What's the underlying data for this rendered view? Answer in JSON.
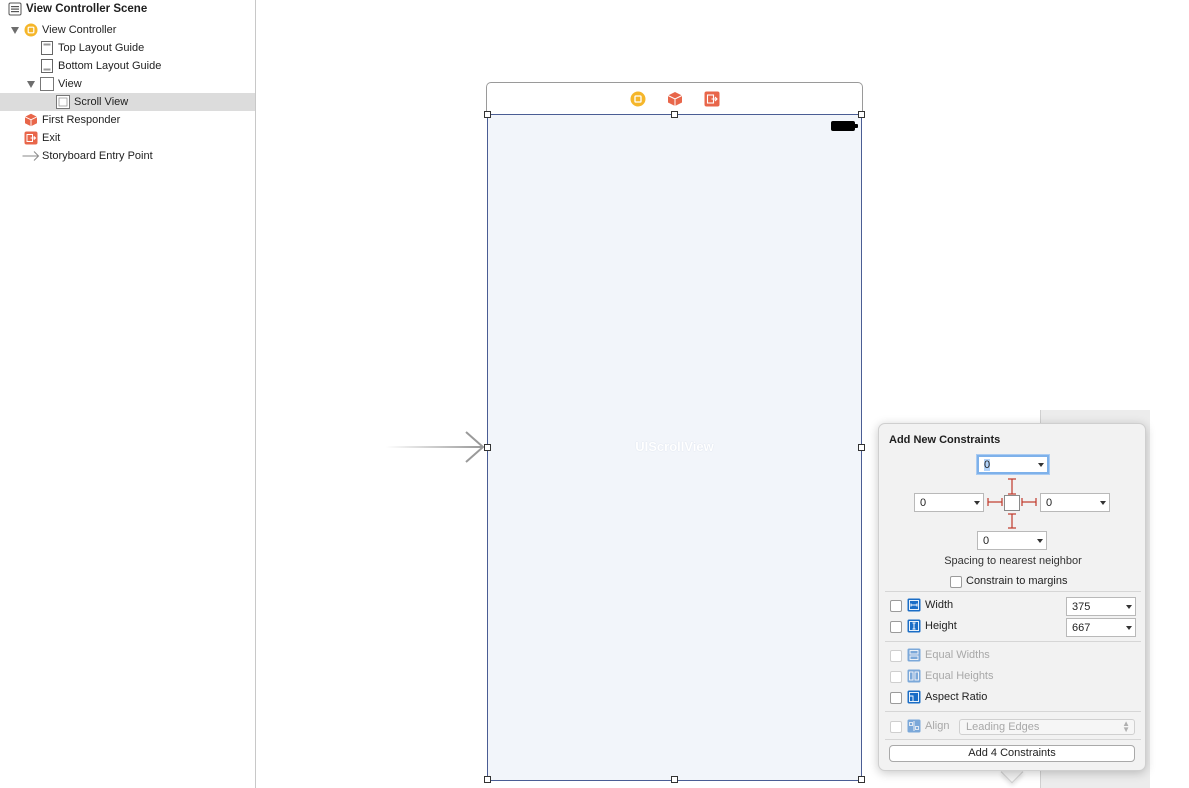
{
  "outline": {
    "scene_title": "View Controller Scene",
    "items": [
      {
        "label": "View Controller"
      },
      {
        "label": "Top Layout Guide"
      },
      {
        "label": "Bottom Layout Guide"
      },
      {
        "label": "View"
      },
      {
        "label": "Scroll View"
      },
      {
        "label": "First Responder"
      },
      {
        "label": "Exit"
      },
      {
        "label": "Storyboard Entry Point"
      }
    ]
  },
  "canvas": {
    "scroll_view_caption": "UIScrollView"
  },
  "colors": {
    "vc_icon": "#f5b62a",
    "responder_icon": "#e8664a",
    "exit_icon": "#e8664a",
    "constraint_icon": "#1a6dc6",
    "pin_strut": "#c0392b",
    "selection_row": "#dcdcdc",
    "device_fill": "#f2f5fa"
  },
  "icons": {
    "scene": "scene-icon",
    "view_controller": "view-controller-icon",
    "layout_guide": "layout-guide-icon",
    "view": "view-icon",
    "first_responder": "first-responder-icon",
    "exit": "exit-icon",
    "entry_point": "arrow-right-icon"
  },
  "popover": {
    "title": "Add New Constraints",
    "top_value": "0",
    "left_value": "0",
    "right_value": "0",
    "bottom_value": "0",
    "spacing_caption": "Spacing to nearest neighbor",
    "constrain_margins_label": "Constrain to margins",
    "width_label": "Width",
    "width_value": "375",
    "height_label": "Height",
    "height_value": "667",
    "equal_widths_label": "Equal Widths",
    "equal_heights_label": "Equal Heights",
    "aspect_ratio_label": "Aspect Ratio",
    "align_label": "Align",
    "align_value": "Leading Edges",
    "add_button_label": "Add 4 Constraints"
  }
}
